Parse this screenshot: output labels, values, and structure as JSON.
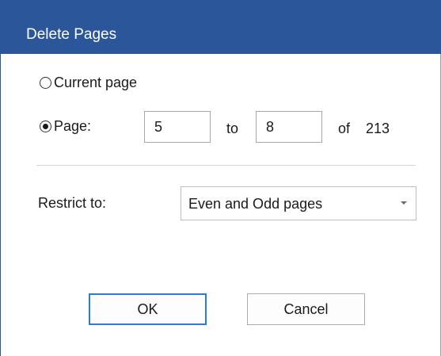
{
  "dialog": {
    "title": "Delete Pages"
  },
  "range": {
    "current_page_label": "Current page",
    "page_label": "Page:",
    "selected_option": "page",
    "from_value": "5",
    "to_label": "to",
    "to_value": "8",
    "of_label": "of",
    "total_pages": "213"
  },
  "restrict": {
    "label": "Restrict to:",
    "selected_value": "Even and Odd pages"
  },
  "buttons": {
    "ok_label": "OK",
    "cancel_label": "Cancel"
  },
  "colors": {
    "titlebar": "#2b579a",
    "ok_border": "#2b7cd6"
  }
}
